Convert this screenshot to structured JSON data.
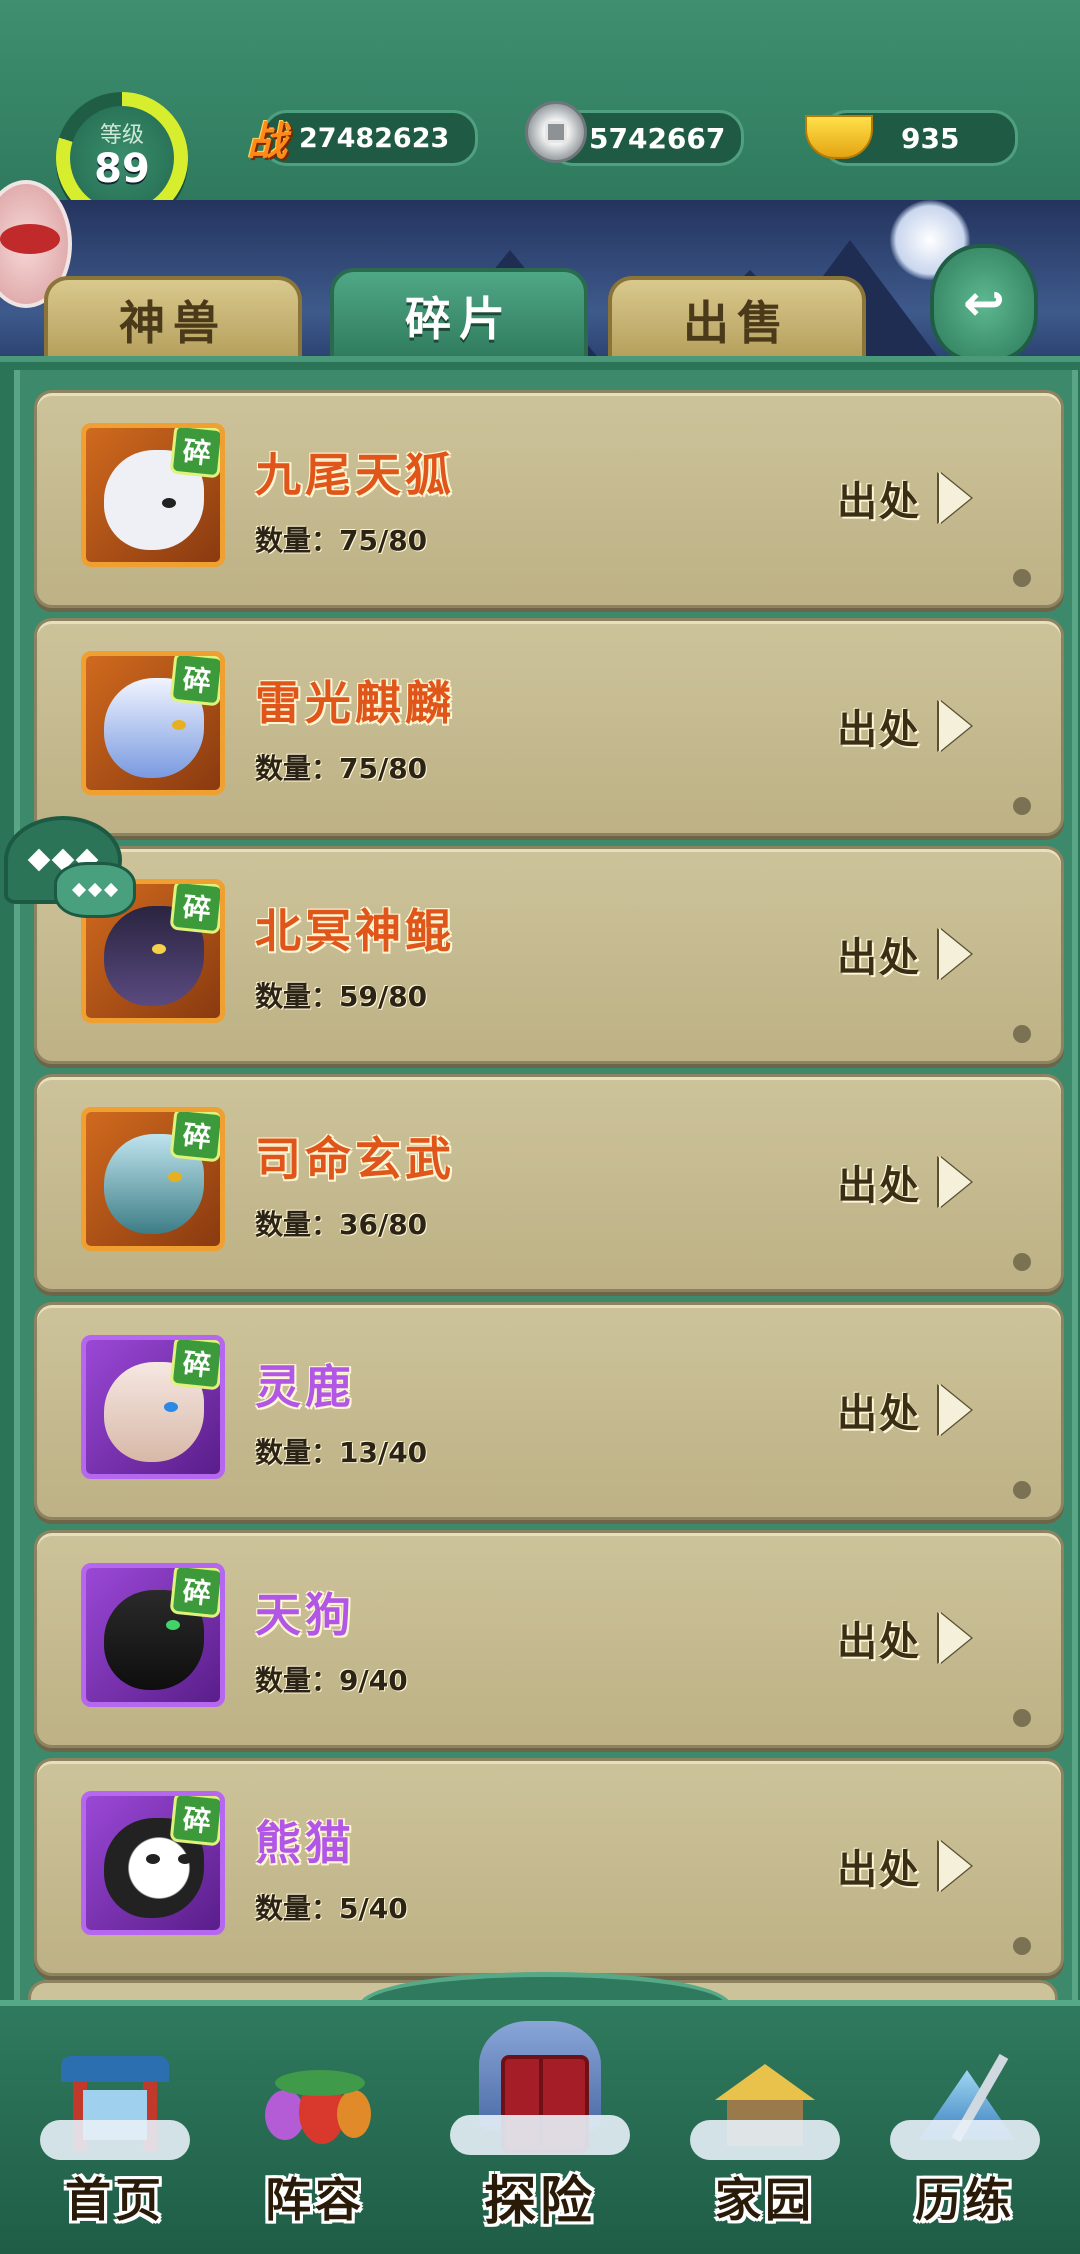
{
  "header": {
    "level_label": "等级",
    "level_value": "89",
    "level_progress": 0.8,
    "combat_power": "27482623",
    "combat_icon_text": "战",
    "silver": "5742667",
    "gold": "935"
  },
  "tabs": [
    {
      "label": "神兽",
      "active": false
    },
    {
      "label": "碎片",
      "active": true
    },
    {
      "label": "出售",
      "active": false
    }
  ],
  "list": {
    "shard_badge": "碎",
    "source_label": "出处",
    "items": [
      {
        "name": "九尾天狐",
        "count": "数量：75/80",
        "rarity": "orange"
      },
      {
        "name": "雷光麒麟",
        "count": "数量：75/80",
        "rarity": "orange"
      },
      {
        "name": "北冥神鲲",
        "count": "数量：59/80",
        "rarity": "orange"
      },
      {
        "name": "司命玄武",
        "count": "数量：36/80",
        "rarity": "orange"
      },
      {
        "name": "灵鹿",
        "count": "数量：13/40",
        "rarity": "purple"
      },
      {
        "name": "天狗",
        "count": "数量：9/40",
        "rarity": "purple"
      },
      {
        "name": "熊猫",
        "count": "数量：5/40",
        "rarity": "purple"
      }
    ]
  },
  "bottom_nav": [
    {
      "label": "首页",
      "icon": "gate-icon"
    },
    {
      "label": "阵容",
      "icon": "gourd-icon"
    },
    {
      "label": "探险",
      "icon": "explore-icon"
    },
    {
      "label": "家园",
      "icon": "house-icon"
    },
    {
      "label": "历练",
      "icon": "sword-icon"
    }
  ],
  "colors": {
    "accent_green": "#2f7a5d",
    "rarity_orange": "#e0561a",
    "rarity_purple": "#b256e6",
    "card_bg": "#c7bc92"
  }
}
